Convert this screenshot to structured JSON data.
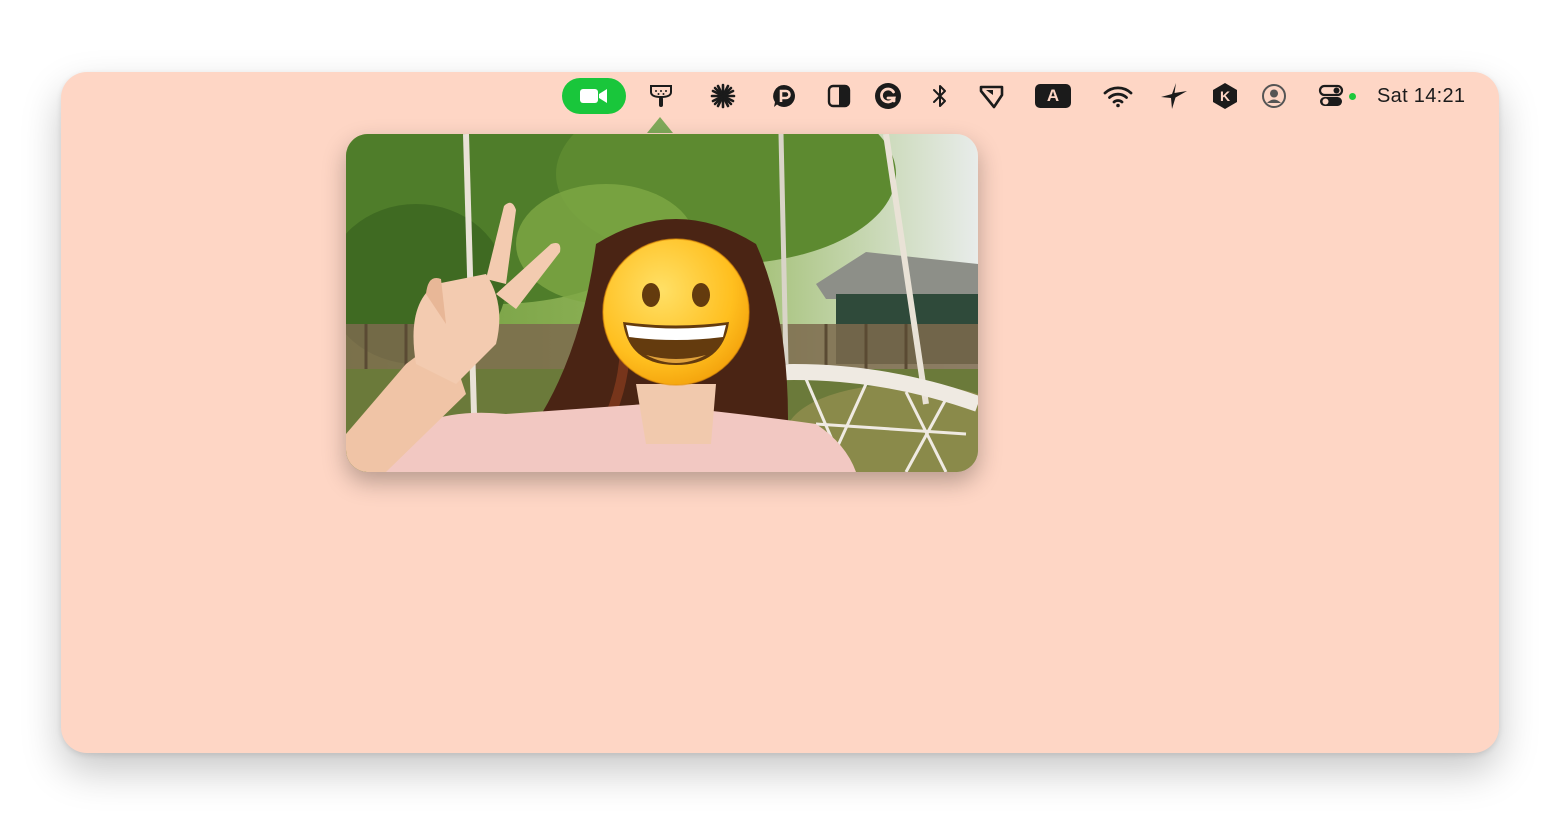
{
  "menubar": {
    "items": [
      {
        "name": "camera-status",
        "icon": "video-camera-icon",
        "active": true
      },
      {
        "name": "shower-head",
        "icon": "shower-head-icon"
      },
      {
        "name": "asterisk-app",
        "icon": "asterisk-icon"
      },
      {
        "name": "pastebot",
        "icon": "p-bubble-icon"
      },
      {
        "name": "display-contrast",
        "icon": "half-square-icon"
      },
      {
        "name": "grammarly",
        "icon": "g-circle-icon"
      },
      {
        "name": "bluetooth",
        "icon": "bluetooth-icon"
      },
      {
        "name": "pointer-tool",
        "icon": "pointer-flag-icon"
      },
      {
        "name": "input-source",
        "icon": "letter-a-icon",
        "label": "A"
      },
      {
        "name": "wifi",
        "icon": "wifi-icon"
      },
      {
        "name": "sparkle-app",
        "icon": "four-point-star-icon"
      },
      {
        "name": "k-app",
        "icon": "k-badge-icon",
        "label": "K"
      },
      {
        "name": "user-account",
        "icon": "user-circle-icon"
      },
      {
        "name": "control-center",
        "icon": "toggles-icon"
      }
    ],
    "clock": "Sat 14:21"
  },
  "camera_preview": {
    "description_icon": "camera-preview-image",
    "overlay_icon": "grinning-face-emoji-icon"
  },
  "colors": {
    "window_bg": "#fed6c5",
    "camera_active": "#19c63b",
    "indicator_dot": "#1ec83c"
  }
}
